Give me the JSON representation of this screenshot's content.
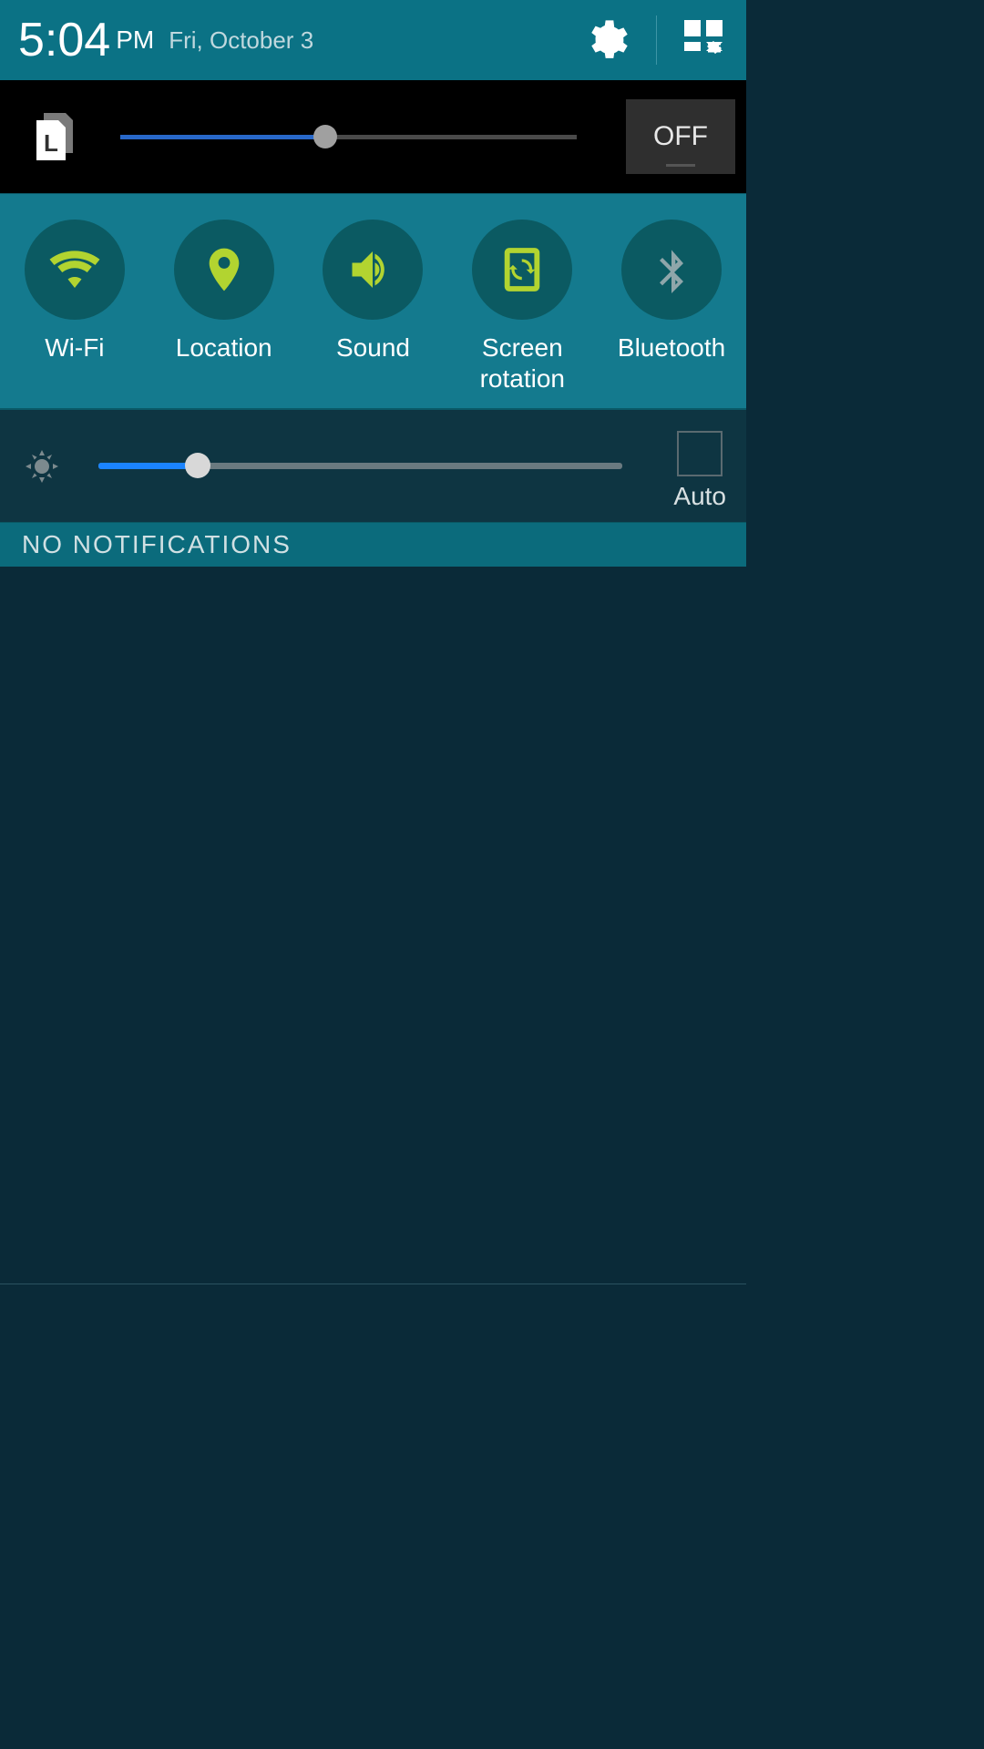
{
  "header": {
    "time": "5:04",
    "ampm": "PM",
    "date": "Fri, October 3"
  },
  "blackbar": {
    "off_label": "OFF",
    "slider_percent": 45
  },
  "toggles": [
    {
      "label": "Wi-Fi",
      "icon": "wifi-icon",
      "active": true
    },
    {
      "label": "Location",
      "icon": "location-icon",
      "active": true
    },
    {
      "label": "Sound",
      "icon": "sound-icon",
      "active": true
    },
    {
      "label": "Screen\nrotation",
      "icon": "rotation-icon",
      "active": true
    },
    {
      "label": "Bluetooth",
      "icon": "bluetooth-icon",
      "active": false
    }
  ],
  "brightness": {
    "slider_percent": 19,
    "auto_label": "Auto",
    "auto_checked": false
  },
  "notifications": {
    "empty_label": "NO NOTIFICATIONS"
  },
  "colors": {
    "accent_active": "#b2d430",
    "accent_inactive": "#8fa6aa",
    "header_bg": "#0b7285",
    "toggle_bg": "#147a8e"
  }
}
